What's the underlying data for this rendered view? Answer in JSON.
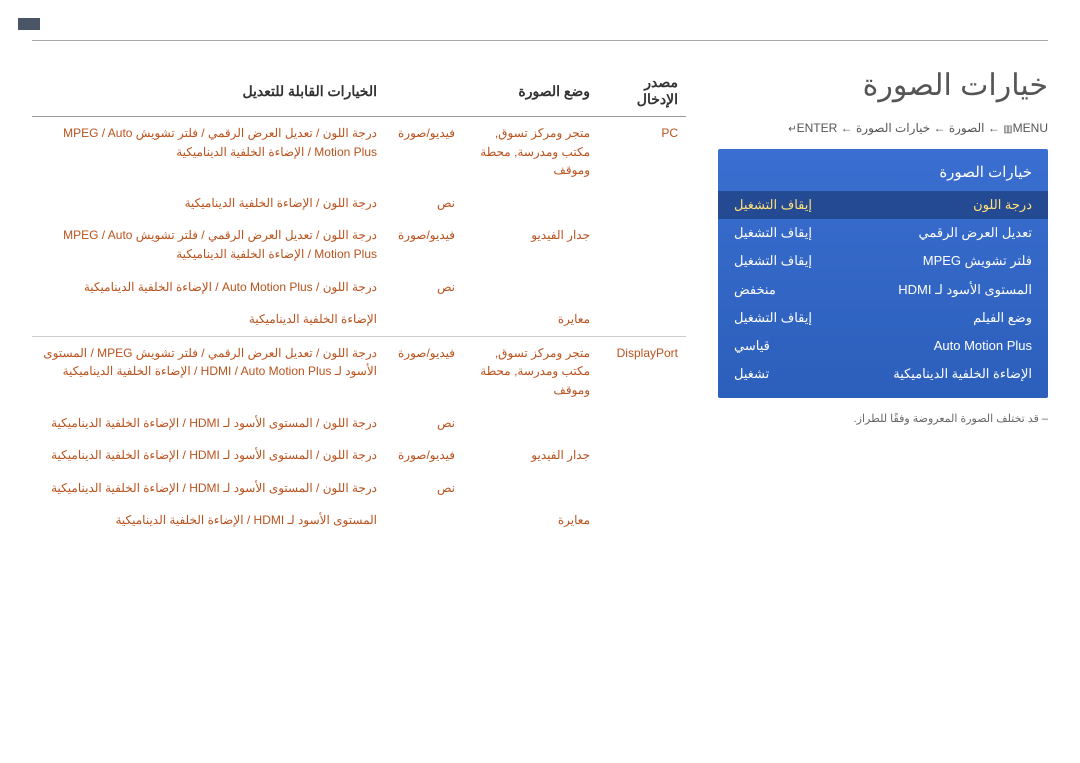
{
  "page_title": "خيارات الصورة",
  "breadcrumb": {
    "menu_label": "MENU",
    "menu_icon": "▥",
    "arrow": "←",
    "seg1": "الصورة",
    "seg2": "خيارات الصورة",
    "enter_label": "ENTER",
    "enter_icon": "↵"
  },
  "panel": {
    "title": "خيارات الصورة",
    "rows": [
      {
        "label": "درجة اللون",
        "value": "إيقاف التشغيل",
        "selected": true
      },
      {
        "label": "تعديل العرض الرقمي",
        "value": "إيقاف التشغيل",
        "selected": false
      },
      {
        "label": "فلتر تشويش MPEG",
        "value": "إيقاف التشغيل",
        "selected": false
      },
      {
        "label": "المستوى الأسود لـ HDMI",
        "value": "منخفض",
        "selected": false
      },
      {
        "label": "وضع الفيلم",
        "value": "إيقاف التشغيل",
        "selected": false
      },
      {
        "label": "Auto Motion Plus",
        "value": "قياسي",
        "selected": false
      },
      {
        "label": "الإضاءة الخلفية الديناميكية",
        "value": "تشغيل",
        "selected": false
      }
    ]
  },
  "note_text": "– قد تختلف الصورة المعروضة وفقًا للطراز.",
  "table": {
    "headers": {
      "source": "مصدر الإدخال",
      "picture_mode": "وضع الصورة",
      "options": "الخيارات القابلة للتعديل"
    },
    "rows": [
      {
        "source": "PC",
        "mode": "متجر ومركز تسوق, مكتب ومدرسة, محطة وموقف",
        "pic": "فيديو/صورة",
        "opts": "درجة اللون / تعديل العرض الرقمي / فلتر تشويش MPEG / Auto Motion Plus / الإضاءة الخلفية الديناميكية"
      },
      {
        "source": "",
        "mode": "",
        "pic": "نص",
        "opts": "درجة اللون / الإضاءة الخلفية الديناميكية"
      },
      {
        "source": "",
        "mode": "جدار الفيديو",
        "pic": "فيديو/صورة",
        "opts": "درجة اللون / تعديل العرض الرقمي / فلتر تشويش MPEG / Auto Motion Plus / الإضاءة الخلفية الديناميكية"
      },
      {
        "source": "",
        "mode": "",
        "pic": "نص",
        "opts": "درجة اللون / Auto Motion Plus / الإضاءة الخلفية الديناميكية"
      },
      {
        "source": "",
        "mode": "معايرة",
        "pic": "",
        "opts": "الإضاءة الخلفية الديناميكية"
      },
      {
        "source": "DisplayPort",
        "mode": "متجر ومركز تسوق, مكتب ومدرسة, محطة وموقف",
        "pic": "فيديو/صورة",
        "opts": "درجة اللون / تعديل العرض الرقمي / فلتر تشويش MPEG / المستوى الأسود لـ HDMI / Auto Motion Plus / الإضاءة الخلفية الديناميكية"
      },
      {
        "source": "",
        "mode": "",
        "pic": "نص",
        "opts": "درجة اللون / المستوى الأسود لـ HDMI / الإضاءة الخلفية الديناميكية"
      },
      {
        "source": "",
        "mode": "جدار الفيديو",
        "pic": "فيديو/صورة",
        "opts": "درجة اللون / المستوى الأسود لـ HDMI / الإضاءة الخلفية الديناميكية"
      },
      {
        "source": "",
        "mode": "",
        "pic": "نص",
        "opts": "درجة اللون / المستوى الأسود لـ HDMI / الإضاءة الخلفية الديناميكية"
      },
      {
        "source": "",
        "mode": "معايرة",
        "pic": "",
        "opts": "المستوى الأسود لـ HDMI / الإضاءة الخلفية الديناميكية"
      }
    ]
  }
}
